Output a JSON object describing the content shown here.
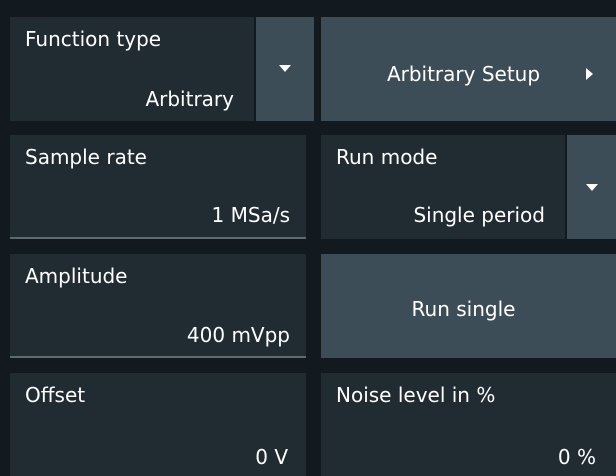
{
  "function_type": {
    "label": "Function type",
    "value": "Arbitrary",
    "dropdown_icon": "triangle-down"
  },
  "arbitrary_setup": {
    "label": "Arbitrary Setup",
    "icon": "triangle-right"
  },
  "sample_rate": {
    "label": "Sample rate",
    "value": "1 MSa/s"
  },
  "run_mode": {
    "label": "Run mode",
    "value": "Single period",
    "dropdown_icon": "triangle-down"
  },
  "amplitude": {
    "label": "Amplitude",
    "value": "400 mVpp"
  },
  "run_single": {
    "label": "Run single"
  },
  "offset": {
    "label": "Offset",
    "value": "0 V"
  },
  "noise_level": {
    "label": "Noise level in %",
    "value": "0 %"
  },
  "colors": {
    "panel_background": "#121a20",
    "cell_background": "#212b32",
    "button_background": "#3d4d57",
    "underline": "#5d6a72",
    "text": "#ffffff"
  }
}
